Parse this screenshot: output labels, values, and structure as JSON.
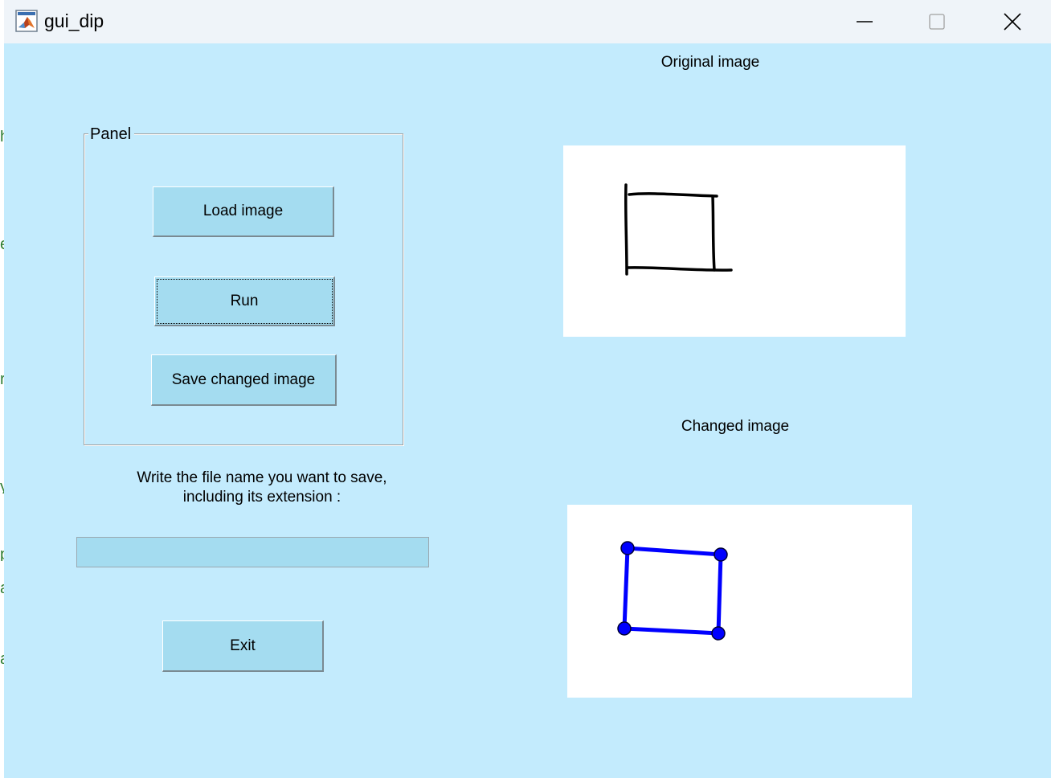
{
  "window": {
    "title": "gui_dip"
  },
  "panel": {
    "title": "Panel",
    "buttons": {
      "load": "Load image",
      "run": "Run",
      "save": "Save changed image"
    }
  },
  "filename": {
    "prompt_line1": "Write the file name you want to save,",
    "prompt_line2": "including its extension :",
    "value": ""
  },
  "exit_label": "Exit",
  "original": {
    "title": "Original image"
  },
  "changed": {
    "title": "Changed image",
    "marker_color": "#0000ff"
  },
  "colors": {
    "figure_background": "#c3ebfd",
    "button_face": "#a4dcf0",
    "titlebar": "#eff4f9"
  },
  "icons": [
    "matlab-icon",
    "minimize-icon",
    "maximize-icon",
    "close-icon"
  ]
}
